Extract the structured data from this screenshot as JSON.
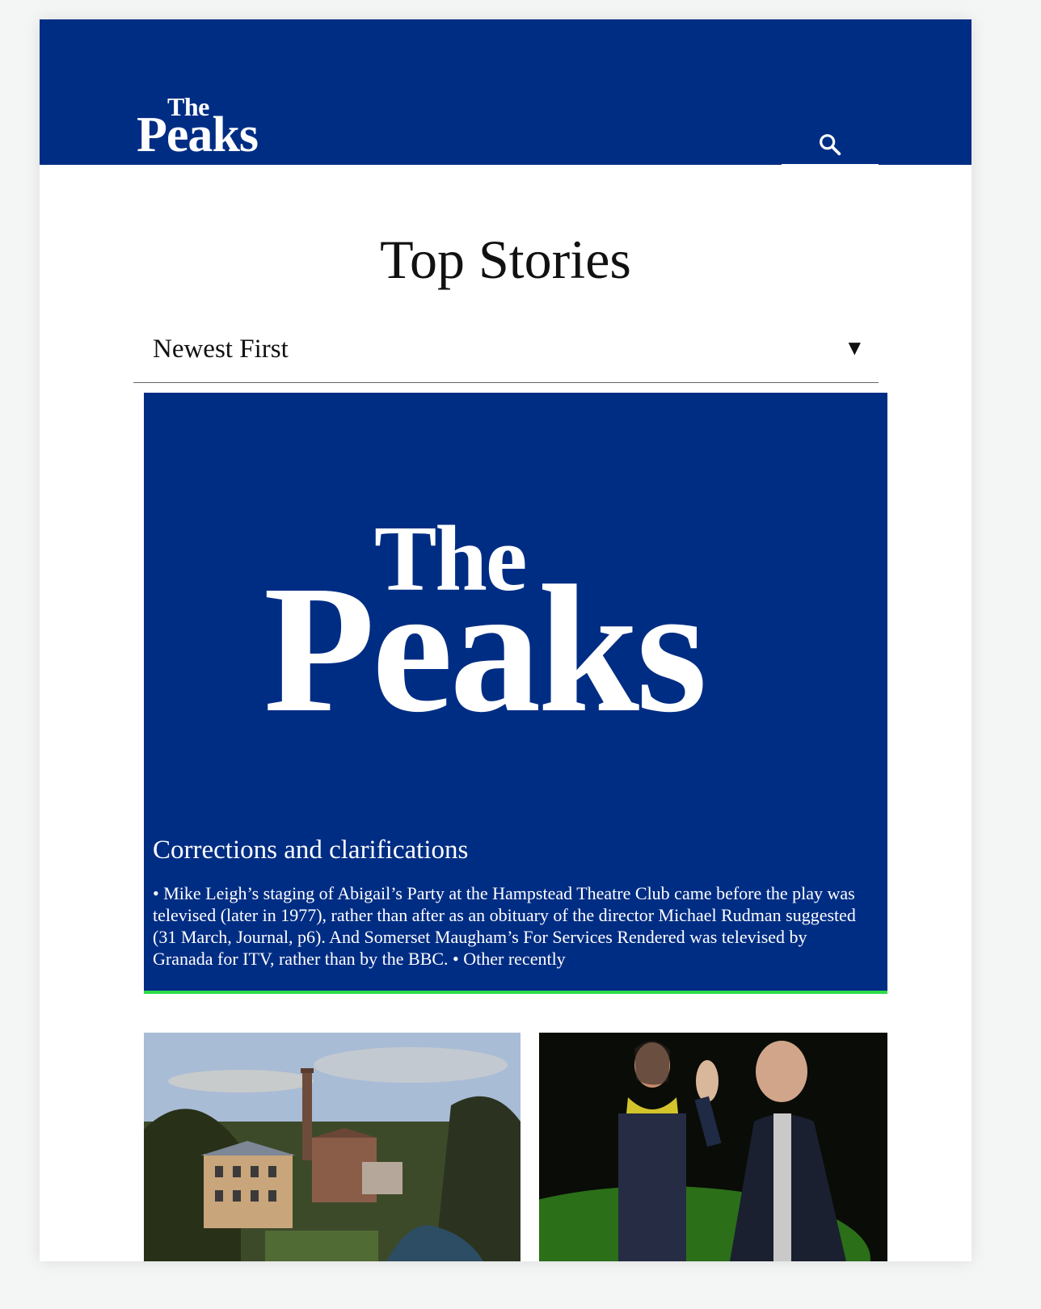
{
  "masthead": {
    "logo_the": "The",
    "logo_peaks": "Peaks",
    "search_icon": "search-icon",
    "background": "#002d84"
  },
  "main": {
    "title": "Top Stories",
    "sort": {
      "selected": "Newest First"
    }
  },
  "featured": {
    "logo_the": "The",
    "logo_peaks": "Peaks",
    "headline": "Corrections and clarifications",
    "body": "• Mike Leigh’s staging of Abigail’s Party at the Hampstead Theatre Club came before the play was televised (later in 1977), rather than after as an obituary of the director Michael Rudman suggested (31 March, Journal, p6). And Somerset Maugham’s For Services Rendered was televised by Granada for ITV, rather than by the BBC. • Other recently",
    "accent": "#2fdc46"
  },
  "thumbnails": [
    {
      "image": "mill-building-photo"
    },
    {
      "image": "couple-waving-photo"
    }
  ]
}
